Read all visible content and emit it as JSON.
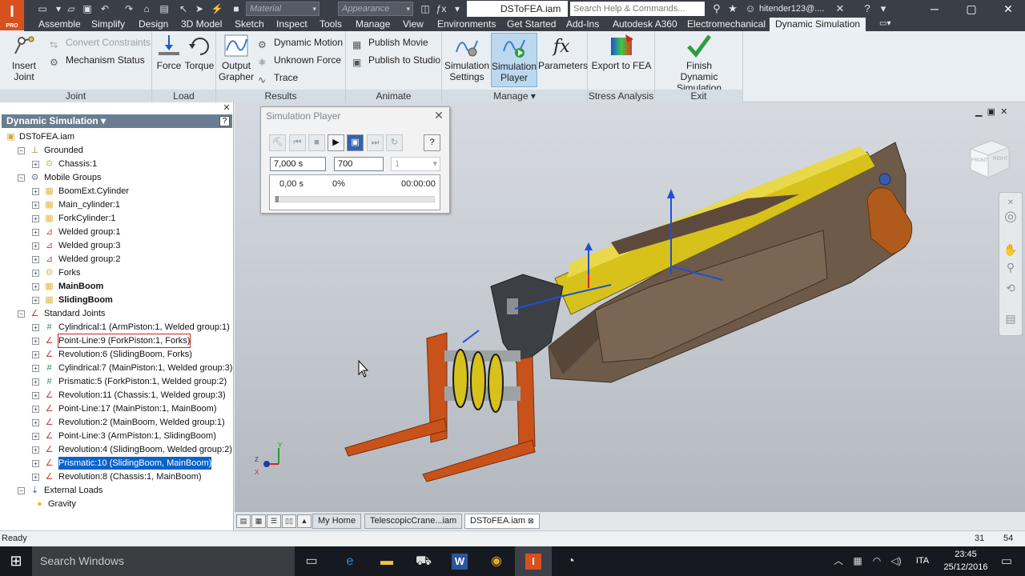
{
  "app": {
    "logo_letter": "I",
    "logo_sub": "PRO",
    "document_title": "DSToFEA.iam"
  },
  "titlebar": {
    "material_placeholder": "Material",
    "appearance_placeholder": "Appearance",
    "help_search_placeholder": "Search Help & Commands...",
    "user_name": "hitender123@...."
  },
  "ribbon_tabs": [
    "Assemble",
    "Simplify",
    "Design",
    "3D Model",
    "Sketch",
    "Inspect",
    "Tools",
    "Manage",
    "View",
    "Environments",
    "Get Started",
    "Add-Ins",
    "Autodesk A360",
    "Electromechanical",
    "Dynamic Simulation"
  ],
  "ribbon": {
    "joint": {
      "label": "Joint",
      "insert_joint": "Insert Joint",
      "convert_constraints": "Convert Constraints",
      "mechanism_status": "Mechanism Status"
    },
    "load": {
      "label": "Load",
      "force": "Force",
      "torque": "Torque"
    },
    "results": {
      "label": "Results",
      "output_grapher_1": "Output",
      "output_grapher_2": "Grapher",
      "dynamic_motion": "Dynamic Motion",
      "unknown_force": "Unknown Force",
      "trace": "Trace"
    },
    "animate": {
      "label": "Animate",
      "publish_movie": "Publish Movie",
      "publish_to_studio": "Publish to Studio"
    },
    "manage": {
      "label": "Manage",
      "simulation_settings_1": "Simulation",
      "simulation_settings_2": "Settings",
      "simulation_player_1": "Simulation",
      "simulation_player_2": "Player",
      "parameters": "Parameters"
    },
    "stress_analysis": {
      "label": "Stress Analysis",
      "export_to_fea": "Export to FEA"
    },
    "exit": {
      "label": "Exit",
      "finish_1": "Finish",
      "finish_2": "Dynamic Simulation"
    }
  },
  "browser": {
    "header": "Dynamic Simulation",
    "help_glyph": "?",
    "tree": [
      {
        "label": "DSToFEA.iam",
        "indent": 0,
        "toggle": "",
        "icon": "assembly",
        "style": ""
      },
      {
        "label": "Grounded",
        "indent": 1,
        "toggle": "−",
        "icon": "grounded",
        "style": ""
      },
      {
        "label": "Chassis:1",
        "indent": 2,
        "toggle": "+",
        "icon": "part",
        "style": ""
      },
      {
        "label": "Mobile Groups",
        "indent": 1,
        "toggle": "−",
        "icon": "mobile",
        "style": ""
      },
      {
        "label": "BoomExt.Cylinder",
        "indent": 2,
        "toggle": "+",
        "icon": "subasm",
        "style": ""
      },
      {
        "label": "Main_cylinder:1",
        "indent": 2,
        "toggle": "+",
        "icon": "subasm",
        "style": ""
      },
      {
        "label": "ForkCylinder:1",
        "indent": 2,
        "toggle": "+",
        "icon": "subasm",
        "style": ""
      },
      {
        "label": "Welded group:1",
        "indent": 2,
        "toggle": "+",
        "icon": "weld",
        "style": ""
      },
      {
        "label": "Welded group:3",
        "indent": 2,
        "toggle": "+",
        "icon": "weld",
        "style": ""
      },
      {
        "label": "Welded group:2",
        "indent": 2,
        "toggle": "+",
        "icon": "weld",
        "style": ""
      },
      {
        "label": "Forks",
        "indent": 2,
        "toggle": "+",
        "icon": "part",
        "style": ""
      },
      {
        "label": "MainBoom",
        "indent": 2,
        "toggle": "+",
        "icon": "subasm",
        "style": "bold"
      },
      {
        "label": "SlidingBoom",
        "indent": 2,
        "toggle": "+",
        "icon": "subasm",
        "style": "bold"
      },
      {
        "label": "Standard Joints",
        "indent": 1,
        "toggle": "−",
        "icon": "joints",
        "style": ""
      },
      {
        "label": "Cylindrical:1 (ArmPiston:1, Welded group:1)",
        "indent": 2,
        "toggle": "+",
        "icon": "jcyl",
        "style": ""
      },
      {
        "label": "Point-Line:9 (ForkPiston:1, Forks)",
        "indent": 2,
        "toggle": "+",
        "icon": "jrev",
        "style": "redbox"
      },
      {
        "label": "Revolution:6 (SlidingBoom, Forks)",
        "indent": 2,
        "toggle": "+",
        "icon": "jrev",
        "style": ""
      },
      {
        "label": "Cylindrical:7 (MainPiston:1, Welded group:3)",
        "indent": 2,
        "toggle": "+",
        "icon": "jcyl",
        "style": ""
      },
      {
        "label": "Prismatic:5 (ForkPiston:1, Welded group:2)",
        "indent": 2,
        "toggle": "+",
        "icon": "jcyl",
        "style": ""
      },
      {
        "label": "Revolution:11 (Chassis:1, Welded group:3)",
        "indent": 2,
        "toggle": "+",
        "icon": "jrev",
        "style": ""
      },
      {
        "label": "Point-Line:17 (MainPiston:1, MainBoom)",
        "indent": 2,
        "toggle": "+",
        "icon": "jrev",
        "style": ""
      },
      {
        "label": "Revolution:2 (MainBoom, Welded group:1)",
        "indent": 2,
        "toggle": "+",
        "icon": "jrev",
        "style": ""
      },
      {
        "label": "Point-Line:3 (ArmPiston:1, SlidingBoom)",
        "indent": 2,
        "toggle": "+",
        "icon": "jrev",
        "style": ""
      },
      {
        "label": "Revolution:4 (SlidingBoom, Welded group:2)",
        "indent": 2,
        "toggle": "+",
        "icon": "jrev",
        "style": ""
      },
      {
        "label": "Prismatic:10 (SlidingBoom, MainBoom)",
        "indent": 2,
        "toggle": "+",
        "icon": "jrev",
        "style": "hilite"
      },
      {
        "label": "Revolution:8 (Chassis:1, MainBoom)",
        "indent": 2,
        "toggle": "+",
        "icon": "jrev",
        "style": ""
      },
      {
        "label": "External Loads",
        "indent": 1,
        "toggle": "−",
        "icon": "loads",
        "style": ""
      },
      {
        "label": "Gravity",
        "indent": 2,
        "toggle": "",
        "icon": "gravity",
        "style": ""
      }
    ]
  },
  "sim_player": {
    "title": "Simulation Player",
    "final_time": "7,000 s",
    "images": "700",
    "filter": "1",
    "current_time": "0,00 s",
    "percent": "0%",
    "elapsed": "00:00:00",
    "progress": 0,
    "help_glyph": "?"
  },
  "viewcube": {
    "front": "FRONT",
    "right": "RIGHT"
  },
  "triad": {
    "x": "X",
    "y": "Y",
    "z": "Z"
  },
  "doc_tabs": [
    "My Home",
    "TelescopicCrane...iam",
    "DSToFEA.iam"
  ],
  "status": {
    "text": "Ready",
    "count_a": "31",
    "count_b": "54"
  },
  "taskbar": {
    "search_placeholder": "Search Windows",
    "lang": "ITA",
    "time": "23:45",
    "date": "25/12/2016"
  },
  "colors": {
    "accent": "#0a63c9",
    "titlebar": "#3a3f47",
    "ribbon": "#e9eef2",
    "boom_yellow": "#d6c21a",
    "boom_brown": "#6e5a48",
    "fork_orange": "#c9521a"
  }
}
